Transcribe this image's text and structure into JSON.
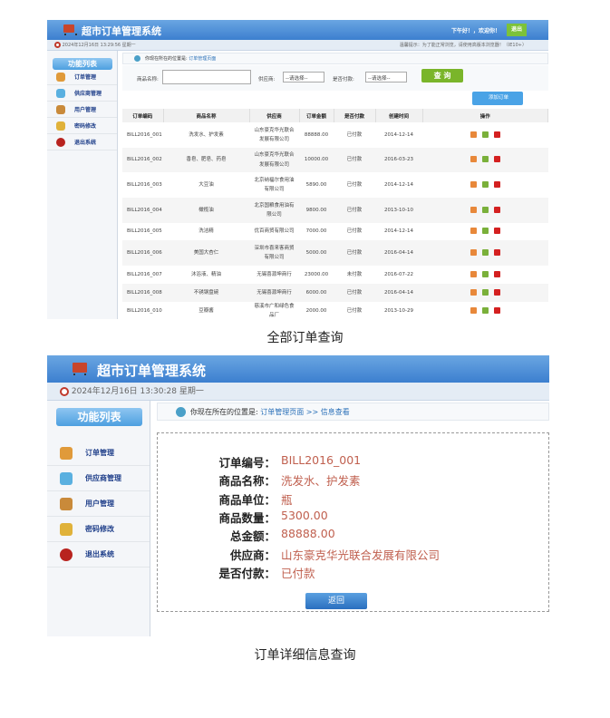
{
  "list_view": {
    "app_title": "超市订单管理系统",
    "greeting": "下午好！，欢迎你！",
    "logout": "退出",
    "datetime": "2024年12月16日 13:29:56 星期一",
    "tip": "温馨提示：为了能正常浏览，请使用高版本浏览器！（IE10+）",
    "menu_title": "功能列表",
    "menu": [
      "订单管理",
      "供应商管理",
      "用户管理",
      "密码修改",
      "退出系统"
    ],
    "breadcrumb_prefix": "你现在所在的位置是:",
    "breadcrumb_page": "订单管理页面",
    "filter": {
      "product_label": "商品名称:",
      "product_value": "",
      "provider_label": "供应商:",
      "provider_value": "--请选择--",
      "paid_label": "是否付款:",
      "paid_value": "--请选择--",
      "search": "查 询"
    },
    "add_button": "添加订单",
    "columns": [
      "订单编码",
      "商品名称",
      "供应商",
      "订单金额",
      "是否付款",
      "创建时间",
      "操作"
    ],
    "rows": [
      [
        "BILL2016_001",
        "洗发水、护发素",
        "山东豪克华光联合发展有限公司",
        "88888.00",
        "已付款",
        "2014-12-14"
      ],
      [
        "BILL2016_002",
        "香皂、肥皂、药皂",
        "山东豪克华光联合发展有限公司",
        "10000.00",
        "已付款",
        "2016-03-23"
      ],
      [
        "BILL2016_003",
        "大豆油",
        "北京纳福尔食用油有限公司",
        "5890.00",
        "已付款",
        "2014-12-14"
      ],
      [
        "BILL2016_004",
        "橄榄油",
        "北京国粮食用油有限公司",
        "9800.00",
        "已付款",
        "2013-10-10"
      ],
      [
        "BILL2016_005",
        "洗洁精",
        "优百商贸有限公司",
        "7000.00",
        "已付款",
        "2014-12-14"
      ],
      [
        "BILL2016_006",
        "美国大杏仁",
        "深圳市喜来客商贸有限公司",
        "5000.00",
        "已付款",
        "2016-04-14"
      ],
      [
        "BILL2016_007",
        "沐浴液、精油",
        "无锡喜源坤商行",
        "23000.00",
        "未付款",
        "2016-07-22"
      ],
      [
        "BILL2016_008",
        "不锈钢盘碗",
        "无锡喜源坤商行",
        "6000.00",
        "已付款",
        "2016-04-14"
      ],
      [
        "BILL2016_010",
        "豆瓣酱",
        "慈溪市广和绿色食品厂",
        "2000.00",
        "已付款",
        "2013-10-29"
      ]
    ],
    "caption": "全部订单查询"
  },
  "detail_view": {
    "app_title": "超市订单管理系统",
    "datetime": "2024年12月16日 13:30:28 星期一",
    "menu_title": "功能列表",
    "menu": [
      "订单管理",
      "供应商管理",
      "用户管理",
      "密码修改",
      "退出系统"
    ],
    "breadcrumb_prefix": "你现在所在的位置是:",
    "breadcrumb_page": "订单管理页面 >> 信息查看",
    "fields": [
      {
        "label": "订单编号：",
        "value": "BILL2016_001"
      },
      {
        "label": "商品名称：",
        "value": "洗发水、护发素"
      },
      {
        "label": "商品单位：",
        "value": "瓶"
      },
      {
        "label": "商品数量：",
        "value": "5300.00"
      },
      {
        "label": "总金额：",
        "value": "88888.00"
      },
      {
        "label": "供应商：",
        "value": "山东豪克华光联合发展有限公司"
      },
      {
        "label": "是否付款：",
        "value": "已付款"
      }
    ],
    "back": "返回",
    "caption": "订单详细信息查询"
  }
}
